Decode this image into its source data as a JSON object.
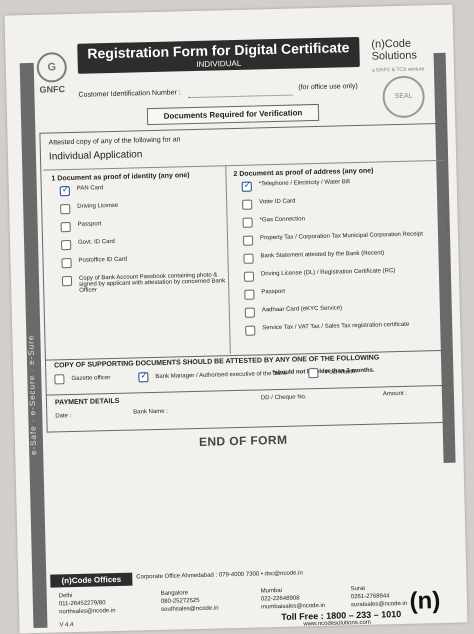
{
  "header": {
    "org": "GNFC",
    "title": "Registration Form for Digital Certificate",
    "subtitle": "INDIVIDUAL",
    "brand": "(n)Code\nSolutions",
    "customer_label": "Customer Identification Number :",
    "office_use": "(for office use only)"
  },
  "docs_title": "Documents Required for Verification",
  "intro": "Attested copy of any of the following for an",
  "section_title": "Individual Application",
  "identity": {
    "title": "1  Document as proof of identity (any one)",
    "items": [
      {
        "label": "PAN Card",
        "checked": true
      },
      {
        "label": "Driving License",
        "checked": false
      },
      {
        "label": "Passport",
        "checked": false
      },
      {
        "label": "Govt. ID Card",
        "checked": false
      },
      {
        "label": "Postoffice ID Card",
        "checked": false
      },
      {
        "label": "Copy of Bank Account Passbook containing photo & signed by applicant with attestation by concerned Bank Officer",
        "checked": false
      }
    ]
  },
  "address": {
    "title": "2  Document as proof of address (any one)",
    "items": [
      {
        "label": "*Telephone / Electricity / Water Bill",
        "checked": true
      },
      {
        "label": "Voter ID Card",
        "checked": false
      },
      {
        "label": "*Gas Connection",
        "checked": false
      },
      {
        "label": "Property Tax / Corporation Tax Municipal Corporation Receipt",
        "checked": false
      },
      {
        "label": "Bank Statement attested by the Bank (Recent)",
        "checked": false
      },
      {
        "label": "Driving License (DL) / Registration Certificate (RC)",
        "checked": false
      },
      {
        "label": "Passport",
        "checked": false
      },
      {
        "label": "Aadhaar Card (eKYC Service)",
        "checked": false
      },
      {
        "label": "Service Tax / VAT Tax / Sales Tax registration certificate",
        "checked": false
      }
    ],
    "note": "*should not be older than 3 months."
  },
  "attest": {
    "title": "COPY OF SUPPORTING DOCUMENTS SHOULD BE ATTESTED BY ANY ONE OF THE FOLLOWING",
    "options": [
      "Gazette officer",
      "Bank Manager / Authorised executive of the Bank",
      "Post Master"
    ]
  },
  "payment": {
    "title": "PAYMENT DETAILS",
    "dd": "DD / Cheque No.",
    "amount": "Amount :",
    "date": "Date :",
    "bank": "Bank Name :"
  },
  "end_text": "END OF FORM",
  "offices": {
    "label": "(n)Code Offices",
    "corporate": "Corporate Office Ahmedabad : 079-4000 7300   •   dsc@ncode.in",
    "cities": [
      {
        "name": "Delhi",
        "phone": "011-26452279/80",
        "email": "northsales@ncode.in"
      },
      {
        "name": "Bangalore",
        "phone": "080-25272525",
        "email": "southsales@ncode.in"
      },
      {
        "name": "Mumbai",
        "phone": "022-22648908",
        "email": "mumbaisales@ncode.in"
      },
      {
        "name": "Surat",
        "phone": "0261-2768944",
        "email": "suratsales@ncode.in"
      }
    ],
    "toll_free": "Toll Free : 1800 – 233 – 1010",
    "website": "www.ncodesolutions.com",
    "version": "V 4.4"
  }
}
